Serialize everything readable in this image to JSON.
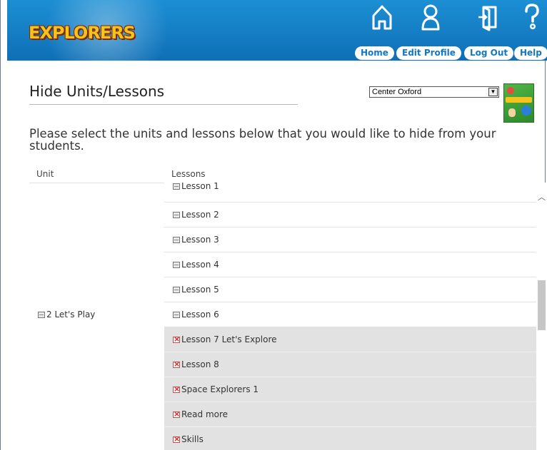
{
  "brand": {
    "logo_text": "EXPLORERS"
  },
  "nav": [
    {
      "label": "Home",
      "icon": "home-icon"
    },
    {
      "label": "Edit Profile",
      "icon": "user-icon"
    },
    {
      "label": "Log Out",
      "icon": "logout-icon"
    },
    {
      "label": "Help",
      "icon": "help-icon"
    }
  ],
  "page": {
    "title": "Hide Units/Lessons",
    "school_select": {
      "selected": "Center Oxford"
    },
    "instructions": "Please select the units and lessons below that you would like to hide from your students.",
    "columns": {
      "unit": "Unit",
      "lessons": "Lessons"
    }
  },
  "unit": {
    "label": "2 Let's Play",
    "hidden": false
  },
  "lessons": [
    {
      "label": "Lesson 1",
      "hidden": false
    },
    {
      "label": "Lesson 2",
      "hidden": false
    },
    {
      "label": "Lesson 3",
      "hidden": false
    },
    {
      "label": "Lesson 4",
      "hidden": false
    },
    {
      "label": "Lesson 5",
      "hidden": false
    },
    {
      "label": "Lesson 6",
      "hidden": false
    },
    {
      "label": "Lesson 7 Let's Explore",
      "hidden": true
    },
    {
      "label": "Lesson 8",
      "hidden": true
    },
    {
      "label": "Space Explorers 1",
      "hidden": true
    },
    {
      "label": "Read more",
      "hidden": true
    },
    {
      "label": "Skills",
      "hidden": true
    }
  ],
  "colors": {
    "header_blue": "#1478c1",
    "logo_gold": "#f6c21c",
    "hidden_row": "#e2e2e2",
    "hidden_mark": "#d81e1e"
  }
}
